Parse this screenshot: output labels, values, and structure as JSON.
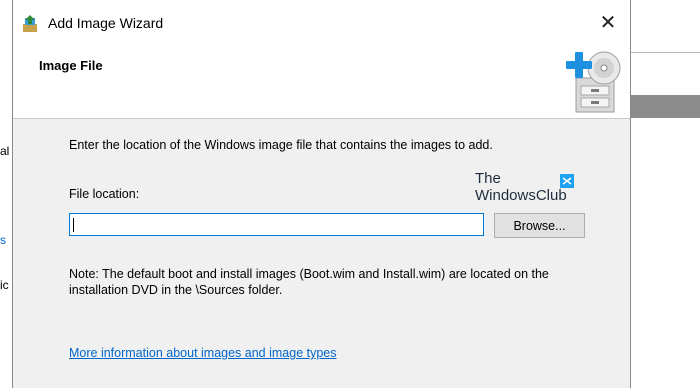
{
  "background": {
    "left_fragments": [
      {
        "text": "al",
        "color": "#000000"
      },
      {
        "text": "s",
        "color": "#0066cc"
      },
      {
        "text": "ic",
        "color": "#000000"
      }
    ]
  },
  "window": {
    "title": "Add Image Wizard",
    "close_glyph": "✕"
  },
  "header": {
    "heading": "Image File",
    "icon": "wizard-add-disk-icon"
  },
  "body": {
    "instruction": "Enter the location of the Windows image file that contains the images to add.",
    "file_label": "File location:",
    "file_value": "",
    "browse_label": "Browse...",
    "note": "Note: The default boot and install images (Boot.wim and Install.wim) are located on the installation DVD in the \\Sources folder.",
    "more_info_link": "More information about images and image types"
  },
  "watermark": {
    "line1": "The",
    "line2": "WindowsClub"
  },
  "colors": {
    "accent": "#0078d7",
    "link": "#0066cc",
    "body_bg": "#f0f0f0"
  }
}
